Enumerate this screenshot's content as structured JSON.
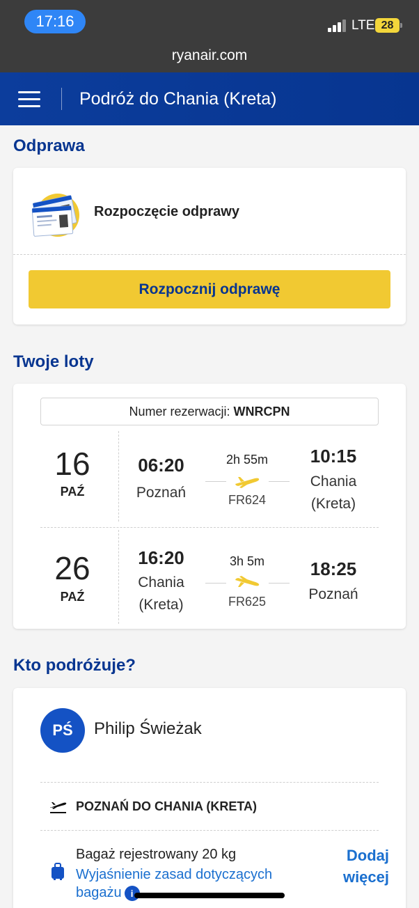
{
  "status_bar": {
    "time": "17:16",
    "network": "LTE",
    "battery": "28"
  },
  "browser": {
    "url": "ryanair.com"
  },
  "header": {
    "title": "Podróż do Chania (Kreta)"
  },
  "checkin": {
    "section_title": "Odprawa",
    "label": "Rozpoczęcie odprawy",
    "button": "Rozpocznij odprawę"
  },
  "flights": {
    "section_title": "Twoje loty",
    "booking_label": "Numer rezerwacji:",
    "booking_code": "WNRCPN",
    "items": [
      {
        "day": "16",
        "month": "PAŹ",
        "dep_time": "06:20",
        "dep_city": "Poznań",
        "duration": "2h 55m",
        "flight_no": "FR624",
        "arr_time": "10:15",
        "arr_city": "Chania (Kreta)"
      },
      {
        "day": "26",
        "month": "PAŹ",
        "dep_time": "16:20",
        "dep_city": "Chania (Kreta)",
        "duration": "3h 5m",
        "flight_no": "FR625",
        "arr_time": "18:25",
        "arr_city": "Poznań"
      }
    ]
  },
  "travellers": {
    "section_title": "Kto podróżuje?",
    "initials": "PŚ",
    "name": "Philip Świeżak",
    "route": "POZNAŃ DO CHANIA (KRETA)",
    "bag_text": "Bagaż rejestrowany 20 kg",
    "bag_link": "Wyjaśnienie zasad dotyczących bagażu",
    "add_more": "Dodaj więcej"
  },
  "colors": {
    "brand_blue": "#073590",
    "accent_yellow": "#f1c932",
    "link_blue": "#1a6fcf"
  }
}
